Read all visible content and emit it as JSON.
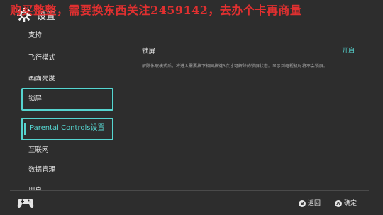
{
  "watermark": "购买整整，需要换东西关注2459142，去办个卡再商量",
  "header": {
    "title": "设置",
    "icon": "gear-icon"
  },
  "sidebar": {
    "items": [
      {
        "label": "支持"
      },
      {
        "label": "飞行模式"
      },
      {
        "label": "画面亮度"
      },
      {
        "label": "锁屏"
      },
      {
        "label": "Parental Controls设置"
      },
      {
        "label": "互联网"
      },
      {
        "label": "数据管理"
      },
      {
        "label": "用户"
      }
    ]
  },
  "main": {
    "setting": {
      "label": "锁屏",
      "value": "开启"
    },
    "description": "解除休眠模式后，将进入需要按下相同按键3次才可解除的锁屏状态。显示到电视机时将不会锁屏。"
  },
  "footer": {
    "back": {
      "button": "B",
      "label": "返回"
    },
    "confirm": {
      "button": "A",
      "label": "确定"
    },
    "controller_icon": "controller-icon"
  },
  "colors": {
    "accent": "#56d5d0",
    "background": "#2d2d2d",
    "watermark": "#e03030"
  }
}
